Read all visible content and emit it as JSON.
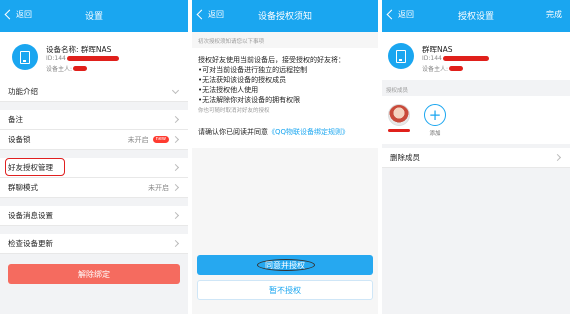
{
  "colors": {
    "accent": "#1aa6f0",
    "danger": "#f56b5f",
    "highlight": "#e02020"
  },
  "panel1": {
    "back_label": "返回",
    "title": "设置",
    "device_name": "设备名称: 群晖NAS",
    "device_id": "ID:144",
    "device_owner": "设备主人:",
    "features_label": "功能介绍",
    "remark_label": "备注",
    "lock_label": "设备锁",
    "lock_value": "未开启",
    "lock_badge": "new",
    "friend_auth_label": "好友授权管理",
    "group_chat_label": "群聊模式",
    "group_chat_value": "未开启",
    "message_settings_label": "设备消息设置",
    "check_update_label": "检查设备更新",
    "unbind_label": "解除绑定"
  },
  "panel2": {
    "back_label": "返回",
    "title": "设备授权须知",
    "subtitle": "初次授权须知请您以下事项",
    "intro": "授权好友使用当前设备后，接受授权的好友将：",
    "points": [
      "•可对当前设备进行独立的远程控制",
      "•无法获知该设备的授权成员",
      "•无法授权他人使用",
      "•无法解除你对该设备的拥有权限"
    ],
    "cancel_note": "你也可随时取消对好友的授权",
    "confirm_text": "请确认你已阅读并同意",
    "rules_link": "《QQ物联设备绑定规则》",
    "agree_label": "同意并授权",
    "reject_label": "暂不授权"
  },
  "panel3": {
    "back_label": "返回",
    "title": "授权设置",
    "done_label": "完成",
    "device_name": "群晖NAS",
    "device_id": "ID:144",
    "device_owner": "设备主人:",
    "members_label": "授权成员",
    "add_label": "添加",
    "delete_label": "删除成员"
  }
}
